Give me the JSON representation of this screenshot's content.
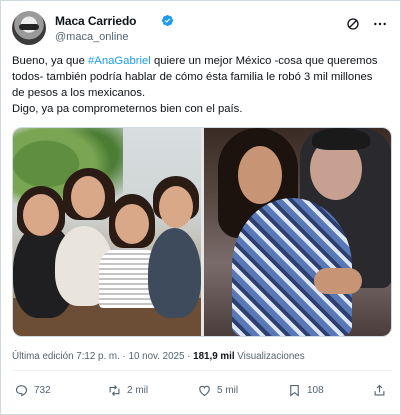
{
  "author": {
    "name": "Maca Carriedo",
    "handle": "@maca_online"
  },
  "tweet": {
    "line1_pre": "Bueno, ya que ",
    "hashtag": "#AnaGabriel",
    "line1_post": " quiere un mejor México -cosa que queremos",
    "line2": "todos- también podría hablar de cómo ésta familia le robó 3 mil millones",
    "line3": "de pesos a los mexicanos.",
    "line4": "Digo, ya pa comprometernos bien con el país."
  },
  "meta": {
    "edited": "Última edición 7:12 p. m. · 10 nov. 2025 · ",
    "views_count": "181,9 mil",
    "views_label": " Visualizaciones"
  },
  "actions": {
    "replies": "732",
    "reposts": "2 mil",
    "likes": "5 mil",
    "bookmarks": "108"
  },
  "colors": {
    "accent": "#1d9bf0",
    "text": "#0f1419",
    "muted": "#536471"
  },
  "icons": [
    "verified-badge-icon",
    "grok-icon",
    "more-icon",
    "reply-icon",
    "repost-icon",
    "like-icon",
    "bookmark-icon",
    "share-icon"
  ]
}
